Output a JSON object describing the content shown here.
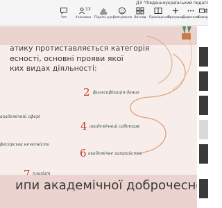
{
  "meeting": {
    "title": "ДЗ \"Південноукраїнський педагогічний університет імені К. Д. Ушинського\""
  },
  "toolbar": {
    "participants_count": "13",
    "items": [
      {
        "label": "Чат",
        "icon": "chat-icon"
      },
      {
        "label": "Учасники",
        "icon": "people-icon"
      },
      {
        "label": "Підніть руку",
        "icon": "raise-hand-icon"
      },
      {
        "label": "Реагування",
        "icon": "reaction-icon"
      },
      {
        "label": "Вигляд",
        "icon": "view-icon"
      },
      {
        "label": "Приміщення",
        "icon": "rooms-icon"
      },
      {
        "label": "Програми",
        "icon": "apps-icon"
      },
      {
        "label": "Додаткові",
        "icon": "more-icon"
      },
      {
        "label": "Камера",
        "icon": "camera-icon"
      }
    ]
  },
  "slide": {
    "title_lines": [
      "атику протиставляється категорія",
      "есності, основні прояви якої",
      "ких видах діяльності:"
    ],
    "items": [
      {
        "number": "2",
        "text": "фальсифікація даних"
      },
      {
        "number": "",
        "text": "академічній сфері"
      },
      {
        "number": "4",
        "text": "академічний саботаж"
      },
      {
        "number": "",
        "text": "фесорська нечесність"
      },
      {
        "number": "6",
        "text": "академічне шахрайство"
      },
      {
        "number": "7",
        "text": "плагіат"
      }
    ],
    "heading2": "ипи академічної доброчесності"
  },
  "colors": {
    "accent_number": "#c0392b",
    "swirl": "#e0a276",
    "item_text": "#2d4a3e",
    "slide_bg": "#f7eeec",
    "slide_band": "#ebd4cf"
  }
}
